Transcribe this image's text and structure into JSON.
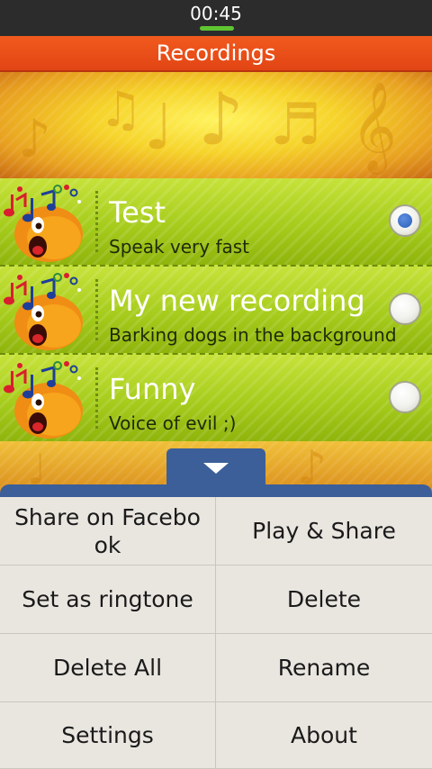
{
  "status_bar": {
    "time": "00:45"
  },
  "title_bar": {
    "title": "Recordings"
  },
  "recordings": [
    {
      "title": "Test",
      "subtitle": "Speak very fast",
      "selected": true
    },
    {
      "title": "My new recording",
      "subtitle": "Barking dogs in the background",
      "selected": false
    },
    {
      "title": "Funny",
      "subtitle": "Voice of evil ;)",
      "selected": false
    }
  ],
  "icons": {
    "recording": "singing-face-icon",
    "menu_toggle": "chevron-down-icon",
    "selection": "radio-button-icon"
  },
  "menu": {
    "items": [
      {
        "label": "Share on Facebook"
      },
      {
        "label": "Play & Share"
      },
      {
        "label": "Set as ringtone"
      },
      {
        "label": "Delete"
      },
      {
        "label": "Delete All"
      },
      {
        "label": "Rename"
      },
      {
        "label": "Settings"
      },
      {
        "label": "About"
      }
    ]
  },
  "colors": {
    "title_bar": "#e8501a",
    "list_row": "#a6cc1c",
    "menu_accent": "#3c5f99",
    "menu_background": "#e9e6e0",
    "radio_selected": "#2f64c0"
  }
}
